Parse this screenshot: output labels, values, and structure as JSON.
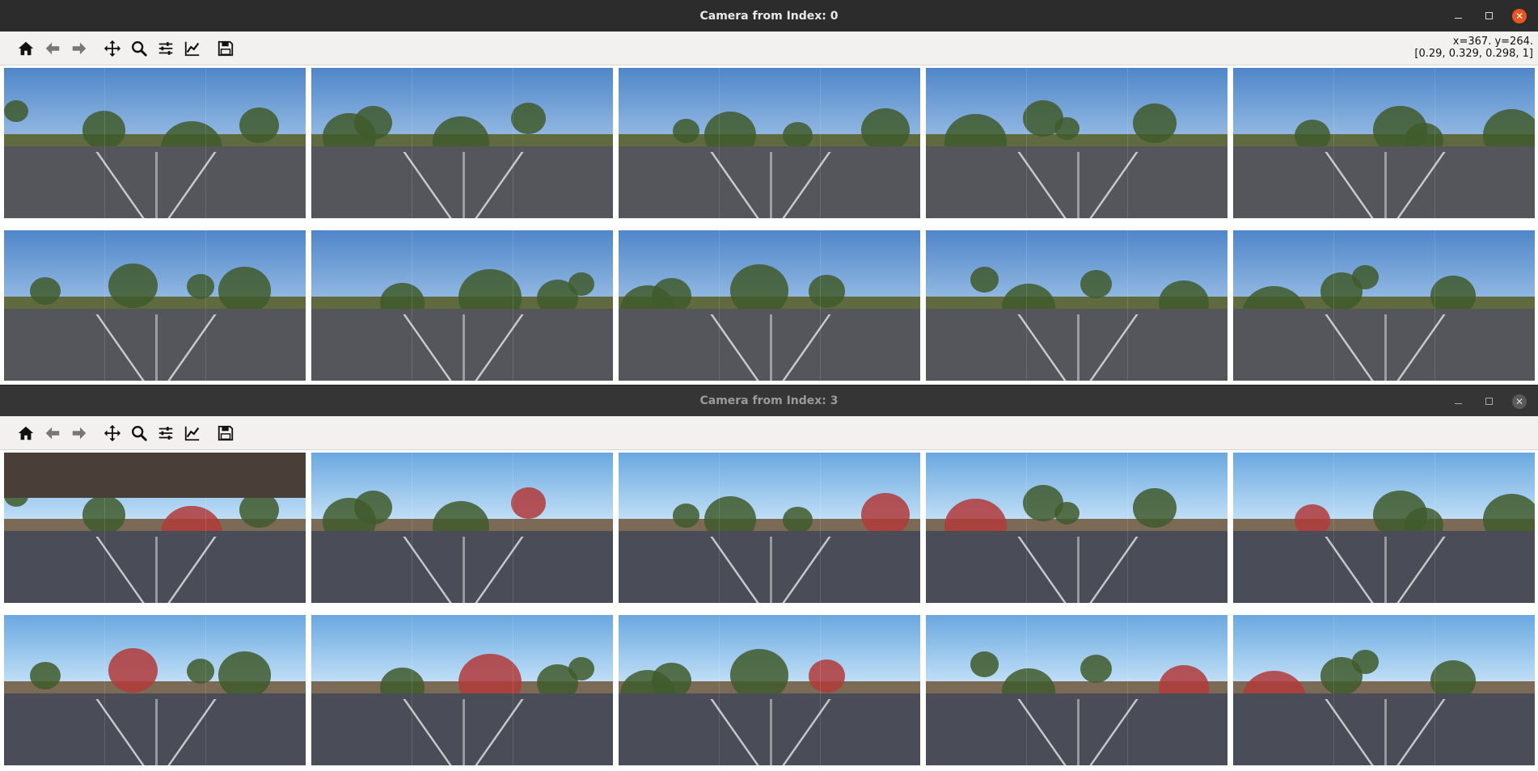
{
  "windows": [
    {
      "title": "Camera from Index: 0",
      "toolbar": [
        "home-icon",
        "back-icon",
        "forward-icon",
        "pan-icon",
        "zoom-icon",
        "configure-icon",
        "axes-icon",
        "save-icon"
      ],
      "coords_line1": "x=367. y=264.",
      "coords_line2": "[0.29, 0.329, 0.298, 1]"
    },
    {
      "title": "Camera from Index: 3",
      "toolbar": [
        "home-icon",
        "back-icon",
        "forward-icon",
        "pan-icon",
        "zoom-icon",
        "configure-icon",
        "axes-icon",
        "save-icon"
      ]
    }
  ],
  "colors": {
    "titlebar_active": "#2c2c2c",
    "titlebar_inactive": "#353535",
    "close_active": "#e95420",
    "toolbar_bg": "#f2f1f0"
  },
  "tiles_per_window": 10
}
